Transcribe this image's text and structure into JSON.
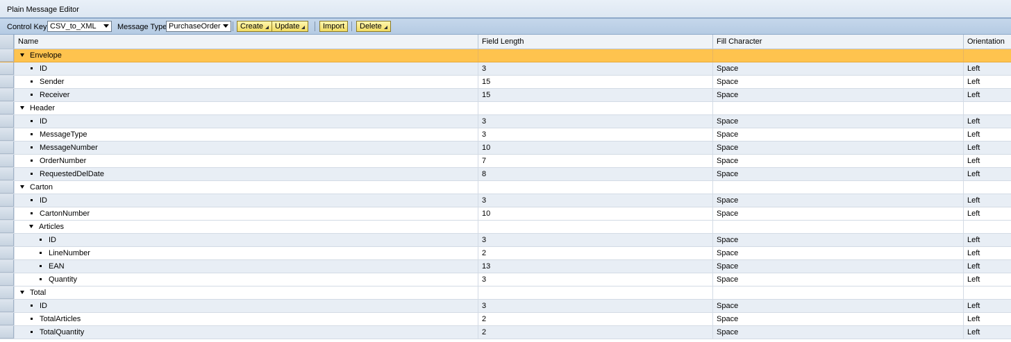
{
  "window": {
    "title": "Plain Message Editor"
  },
  "toolbar": {
    "control_key_label": "Control Key:",
    "control_key_value": "CSV_to_XML",
    "message_type_label": "Message Type:",
    "message_type_value": "PurchaseOrder",
    "create_label": "Create",
    "update_label": "Update",
    "import_label": "Import",
    "delete_label": "Delete"
  },
  "table": {
    "columns": [
      "Name",
      "Field Length",
      "Fill Character",
      "Orientation"
    ],
    "rows": [
      {
        "name": "Envelope",
        "level": 0,
        "node": "folder",
        "length": "",
        "fill": "",
        "orientation": "",
        "selected": true
      },
      {
        "name": "ID",
        "level": 1,
        "node": "leaf",
        "length": "3",
        "fill": "Space",
        "orientation": "Left"
      },
      {
        "name": "Sender",
        "level": 1,
        "node": "leaf",
        "length": "15",
        "fill": "Space",
        "orientation": "Left"
      },
      {
        "name": "Receiver",
        "level": 1,
        "node": "leaf",
        "length": "15",
        "fill": "Space",
        "orientation": "Left"
      },
      {
        "name": "Header",
        "level": 0,
        "node": "folder",
        "length": "",
        "fill": "",
        "orientation": ""
      },
      {
        "name": "ID",
        "level": 1,
        "node": "leaf",
        "length": "3",
        "fill": "Space",
        "orientation": "Left"
      },
      {
        "name": "MessageType",
        "level": 1,
        "node": "leaf",
        "length": "3",
        "fill": "Space",
        "orientation": "Left"
      },
      {
        "name": "MessageNumber",
        "level": 1,
        "node": "leaf",
        "length": "10",
        "fill": "Space",
        "orientation": "Left"
      },
      {
        "name": "OrderNumber",
        "level": 1,
        "node": "leaf",
        "length": "7",
        "fill": "Space",
        "orientation": "Left"
      },
      {
        "name": "RequestedDelDate",
        "level": 1,
        "node": "leaf",
        "length": "8",
        "fill": "Space",
        "orientation": "Left"
      },
      {
        "name": "Carton",
        "level": 0,
        "node": "folder",
        "length": "",
        "fill": "",
        "orientation": ""
      },
      {
        "name": "ID",
        "level": 1,
        "node": "leaf",
        "length": "3",
        "fill": "Space",
        "orientation": "Left"
      },
      {
        "name": "CartonNumber",
        "level": 1,
        "node": "leaf",
        "length": "10",
        "fill": "Space",
        "orientation": "Left"
      },
      {
        "name": "Articles",
        "level": 1,
        "node": "folder",
        "length": "",
        "fill": "",
        "orientation": ""
      },
      {
        "name": "ID",
        "level": 2,
        "node": "leaf",
        "length": "3",
        "fill": "Space",
        "orientation": "Left"
      },
      {
        "name": "LineNumber",
        "level": 2,
        "node": "leaf",
        "length": "2",
        "fill": "Space",
        "orientation": "Left"
      },
      {
        "name": "EAN",
        "level": 2,
        "node": "leaf",
        "length": "13",
        "fill": "Space",
        "orientation": "Left"
      },
      {
        "name": "Quantity",
        "level": 2,
        "node": "leaf",
        "length": "3",
        "fill": "Space",
        "orientation": "Left"
      },
      {
        "name": "Total",
        "level": 0,
        "node": "folder",
        "length": "",
        "fill": "",
        "orientation": ""
      },
      {
        "name": "ID",
        "level": 1,
        "node": "leaf",
        "length": "3",
        "fill": "Space",
        "orientation": "Left"
      },
      {
        "name": "TotalArticles",
        "level": 1,
        "node": "leaf",
        "length": "2",
        "fill": "Space",
        "orientation": "Left"
      },
      {
        "name": "TotalQuantity",
        "level": 1,
        "node": "leaf",
        "length": "2",
        "fill": "Space",
        "orientation": "Left"
      }
    ]
  },
  "colors": {
    "selected_row": "#fec34e",
    "toolbar_button": "#f2dc62",
    "alt_row": "#e8eef5"
  }
}
